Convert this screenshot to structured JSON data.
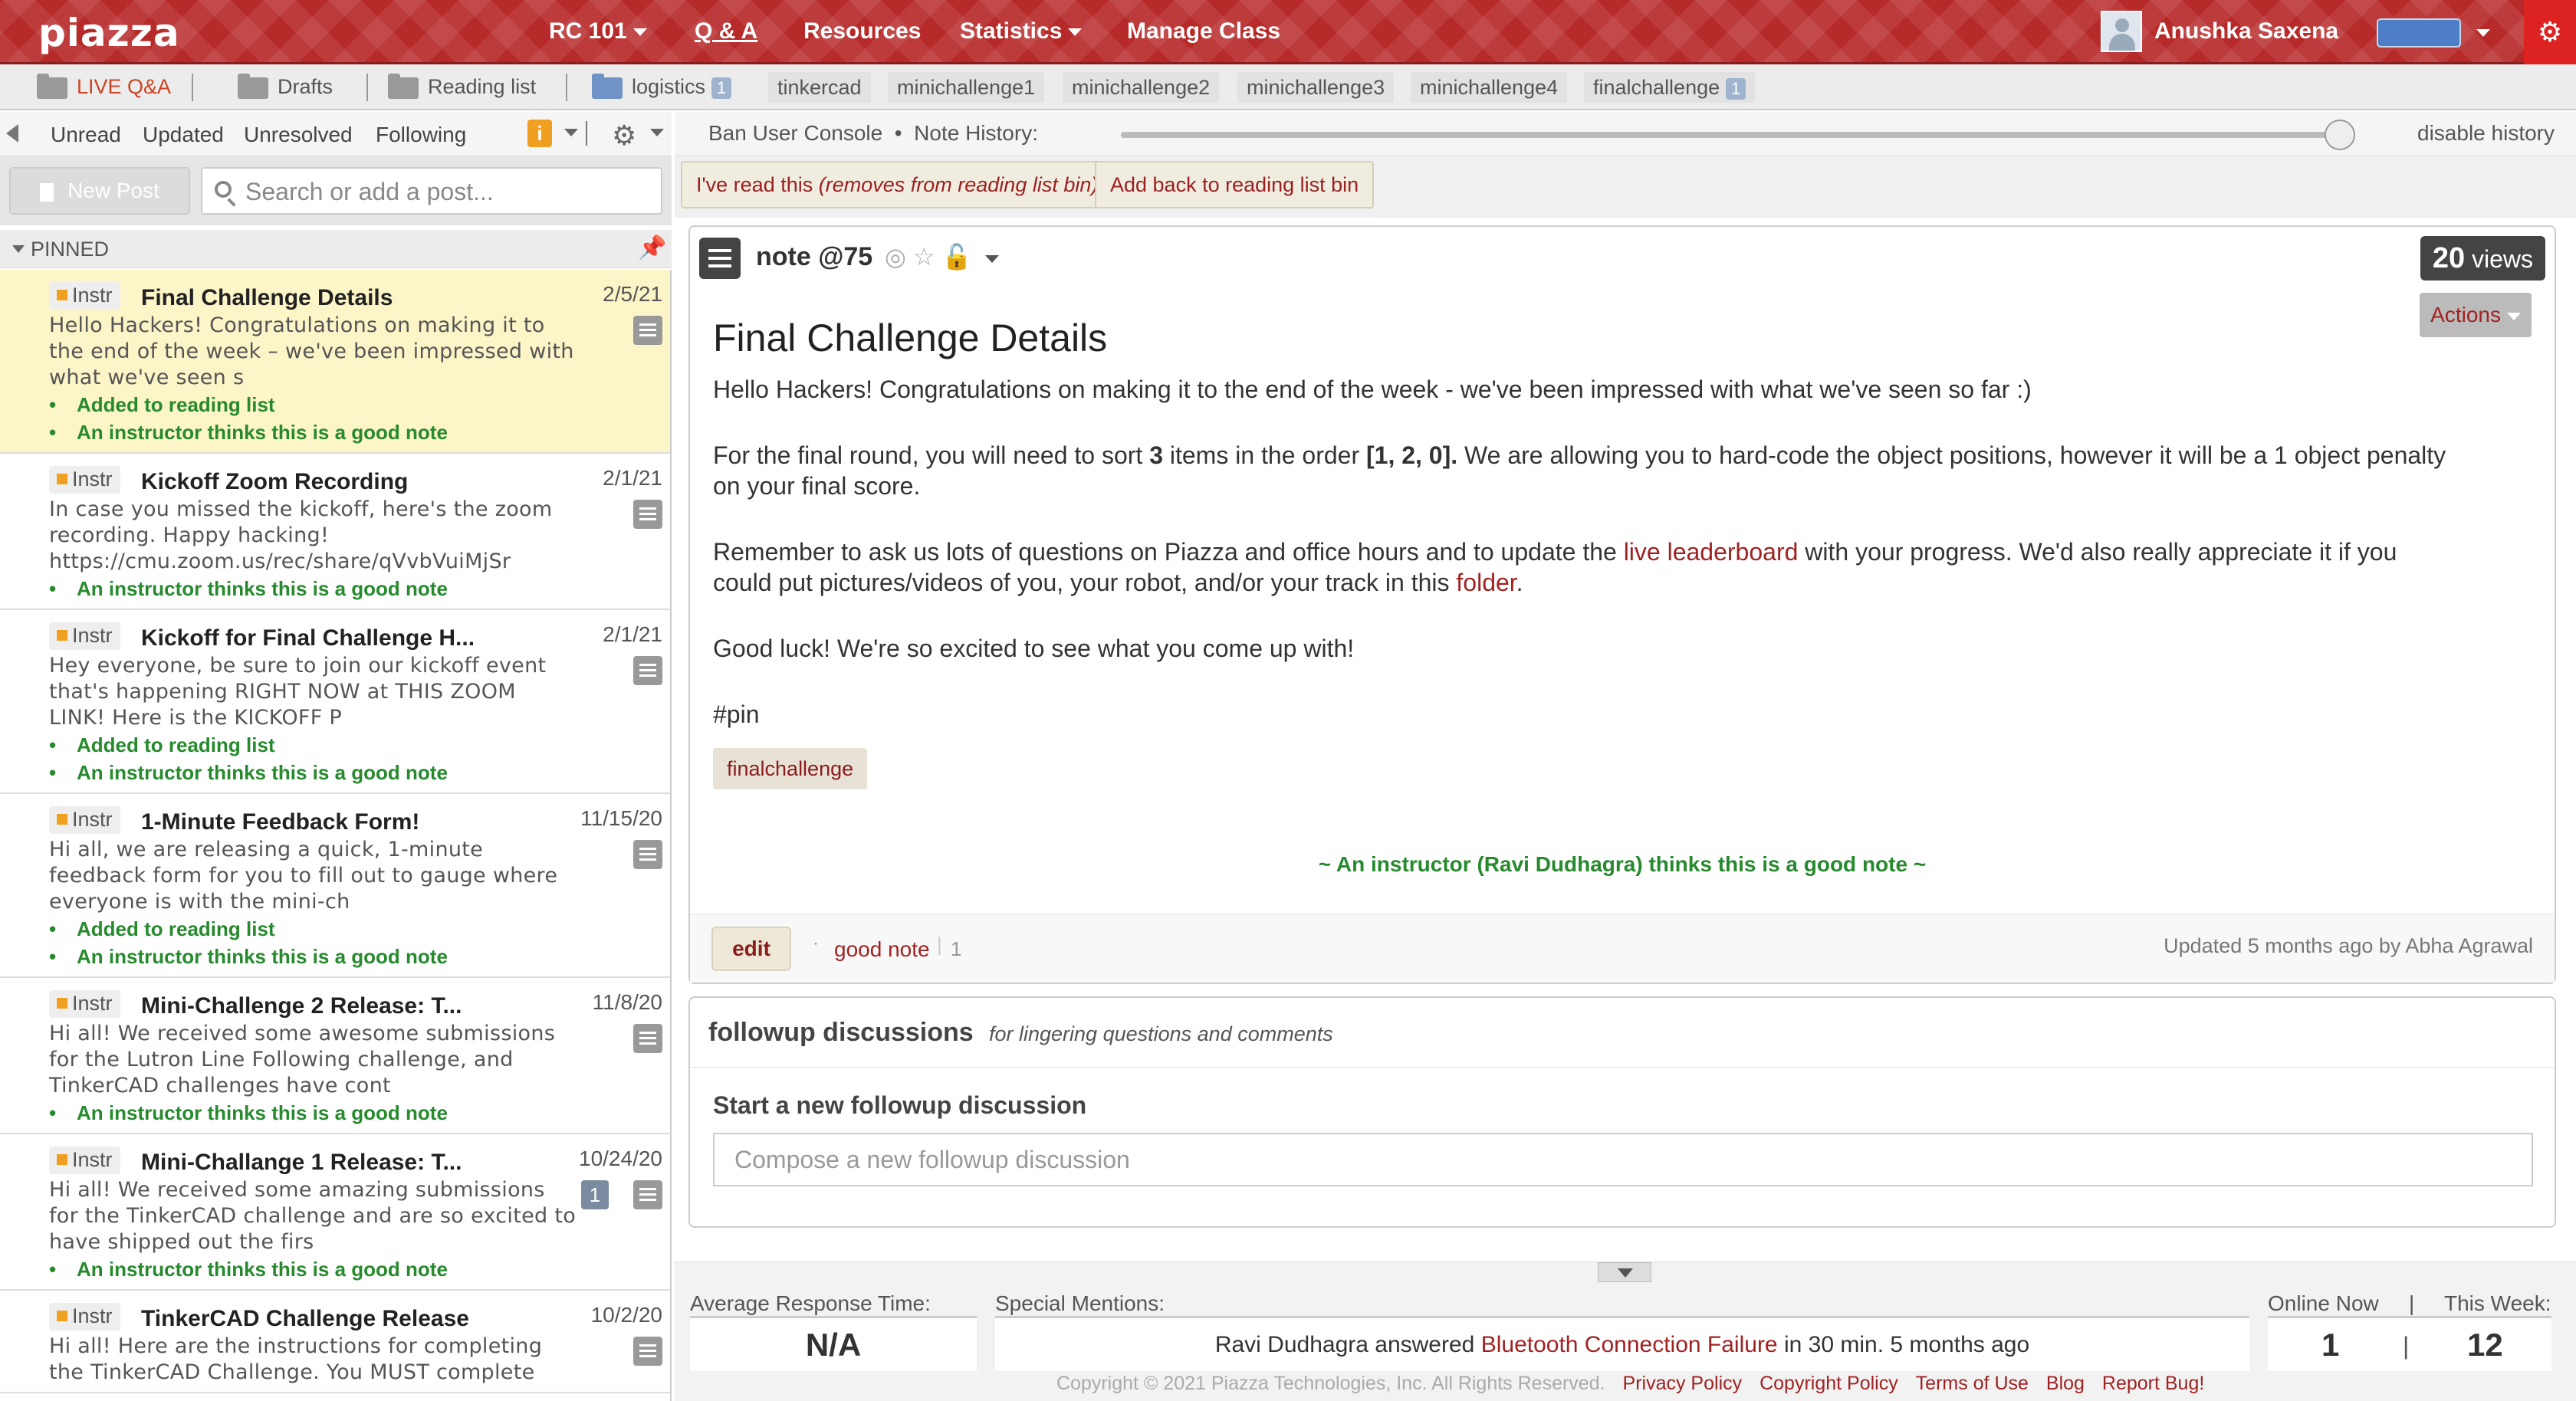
{
  "app": {
    "logo": "piazza",
    "nav": {
      "course": "RC 101",
      "qa": "Q & A",
      "resources": "Resources",
      "statistics": "Statistics",
      "manage": "Manage Class"
    },
    "user": "Anushka Saxena",
    "user_color": "#4d7ec6",
    "accent": "#b72a2a"
  },
  "folders": {
    "live": "LIVE Q&A",
    "drafts": "Drafts",
    "reading": "Reading list",
    "logistics": "logistics",
    "logistics_count": "1",
    "tinkercad": "tinkercad",
    "mini1": "minichallenge1",
    "mini2": "minichallenge2",
    "mini3": "minichallenge3",
    "mini4": "minichallenge4",
    "final": "finalchallenge",
    "final_count": "1"
  },
  "filters": {
    "unread": "Unread",
    "updated": "Updated",
    "unresolved": "Unresolved",
    "following": "Following",
    "info": "i"
  },
  "left": {
    "new_post": "New Post",
    "search_placeholder": "Search or add a post...",
    "pinned": "PINNED"
  },
  "posts": [
    {
      "tag": "Instr",
      "title": "Final Challenge Details",
      "date": "2/5/21",
      "excerpt": "Hello Hackers! Congratulations on making it to the end of the week – we've been impressed with what we've seen s",
      "meta1": "Added to reading list",
      "meta2": "An instructor thinks this is a good note"
    },
    {
      "tag": "Instr",
      "title": "Kickoff Zoom Recording",
      "date": "2/1/21",
      "excerpt": "In case you missed the kickoff, here's the zoom recording. Happy hacking! https://cmu.zoom.us/rec/share/qVvbVuiMjSr",
      "meta1": "An instructor thinks this is a good note"
    },
    {
      "tag": "Instr",
      "title": "Kickoff for Final Challenge H...",
      "date": "2/1/21",
      "excerpt": "Hey everyone, be sure to join our kickoff event that's happening RIGHT NOW at THIS ZOOM LINK! Here is the KICKOFF P",
      "meta1": "Added to reading list",
      "meta2": "An instructor thinks this is a good note"
    },
    {
      "tag": "Instr",
      "title": "1-Minute Feedback Form!",
      "date": "11/15/20",
      "excerpt": "Hi all, we are releasing a quick, 1-minute feedback form for you to fill out to gauge where everyone is with the mini-ch",
      "meta1": "Added to reading list",
      "meta2": "An instructor thinks this is a good note"
    },
    {
      "tag": "Instr",
      "title": "Mini-Challenge 2 Release: T...",
      "date": "11/8/20",
      "excerpt": "Hi all! We received some awesome submissions for the Lutron Line Following challenge, and TinkerCAD challenges have cont",
      "meta1": "An instructor thinks this is a good note"
    },
    {
      "tag": "Instr",
      "title": "Mini-Challange 1 Release: T...",
      "date": "10/24/20",
      "badge": "1",
      "excerpt": "Hi all! We received some amazing submissions for the TinkerCAD challenge and are so excited to have shipped out the firs",
      "meta1": "An instructor thinks this is a good note"
    },
    {
      "tag": "Instr",
      "title": "TinkerCAD Challenge Release",
      "date": "10/2/20",
      "excerpt": "Hi all! Here are the instructions for completing the TinkerCAD Challenge. You MUST complete"
    }
  ],
  "history": {
    "ban": "Ban User Console",
    "note_history": "Note History:",
    "disable": "disable history"
  },
  "reading_buttons": {
    "read": "I've read this ",
    "read_italic": "(removes from reading list bin)",
    "add_back": "Add back to reading list bin"
  },
  "note": {
    "label": "note @75",
    "views_count": "20",
    "views_word": " views",
    "actions": "Actions",
    "title": "Final Challenge Details",
    "p1": "Hello Hackers! Congratulations on making it to the end of the week - we've been impressed with what we've seen so far :)",
    "p2a": "For the final round, you will need to sort ",
    "p2b": "3",
    "p2c": " items in the order ",
    "p2d": "[1, 2, 0].",
    "p2e": " We are allowing you to hard-code the object positions, however it will be a 1 object penalty on your final score.",
    "p3a": "Remember to ask us lots of questions on Piazza and office hours and to update the ",
    "p3link1": "live leaderboard",
    "p3b": " with your progress. We'd also really appreciate it if you could put pictures/videos of you, your robot, and/or your track in this ",
    "p3link2": "folder",
    "p3c": ".",
    "p4": "Good luck! We're so excited to see what you come up with!",
    "p5": "#pin",
    "topic": "finalchallenge",
    "good_note_line": "~ An instructor (Ravi Dudhagra) thinks this is a good note ~",
    "edit": "edit",
    "good_note": "good note",
    "good_note_count": "1",
    "updated": "Updated 5 months ago by Abha Agrawal"
  },
  "followup": {
    "title": "followup discussions",
    "subtitle": "for lingering questions and comments",
    "start": "Start a new followup discussion",
    "placeholder": "Compose a new followup discussion"
  },
  "stats": {
    "avg_label": "Average Response Time:",
    "avg_value": "N/A",
    "mentions_label": "Special Mentions:",
    "mention_pre": "Ravi Dudhagra answered ",
    "mention_link": "Bluetooth Connection Failure",
    "mention_post": " in 30 min. 5 months ago",
    "online_label": "Online Now",
    "week_label": "This Week:",
    "online_value": "1",
    "week_value": "12",
    "sep": "|"
  },
  "footer": {
    "copyright": "Copyright © 2021 Piazza Technologies, Inc. All Rights Reserved.",
    "privacy": "Privacy Policy",
    "copyright_policy": "Copyright Policy",
    "terms": "Terms of Use",
    "blog": "Blog",
    "bug": "Report Bug!"
  }
}
